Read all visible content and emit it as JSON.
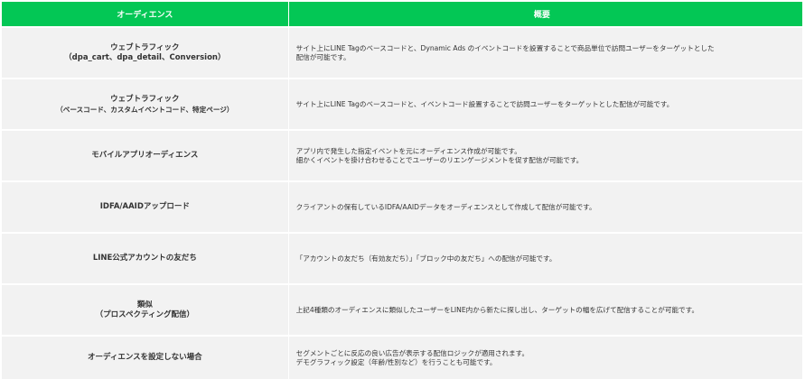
{
  "table": {
    "header": {
      "audience": "オーディエンス",
      "summary": "概要"
    },
    "rows": [
      {
        "audience": [
          "ウェブトラフィック",
          "（dpa_cart、dpa_detail、Conversion）"
        ],
        "summary": [
          "サイト上にLINE Tagのベースコードと、Dynamic Ads のイベントコードを設置することで商品単位で訪問ユーザーをターゲットとした",
          "配信が可能です。"
        ]
      },
      {
        "audience": [
          "ウェブトラフィック",
          "（ベースコード、カスタムイベントコード、特定ページ）"
        ],
        "summary": [
          "サイト上にLINE Tagのベースコードと、イベントコード設置することで訪問ユーザーをターゲットとした配信が可能です。"
        ]
      },
      {
        "audience": [
          "モバイルアプリオーディエンス"
        ],
        "summary": [
          "アプリ内で発生した指定イベントを元にオーディエンス作成が可能です。",
          "細かくイベントを掛け合わせることでユーザーのリエンゲージメントを促す配信が可能です。"
        ]
      },
      {
        "audience": [
          "IDFA/AAIDアップロード"
        ],
        "summary": [
          "クライアントの保有しているIDFA/AAIDデータをオーディエンスとして作成して配信が可能です。"
        ]
      },
      {
        "audience": [
          "LINE公式アカウントの友だち"
        ],
        "summary": [
          "「アカウントの友だち（有効友だち）」「ブロック中の友だち」への配信が可能です。"
        ]
      },
      {
        "audience": [
          "類似",
          "（プロスペクティング配信）"
        ],
        "summary": [
          "上記4種類のオーディエンスに類似したユーザーをLINE内から新たに探し出し、ターゲットの幅を広げて配信することが可能です。"
        ]
      },
      {
        "audience": [
          "オーディエンスを設定しない場合"
        ],
        "summary": [
          "セグメントごとに反応の良い広告が表示する配信ロジックが適用されます。",
          "デモグラフィック設定（年齢/性別など）を行うことも可能です。"
        ]
      }
    ]
  }
}
